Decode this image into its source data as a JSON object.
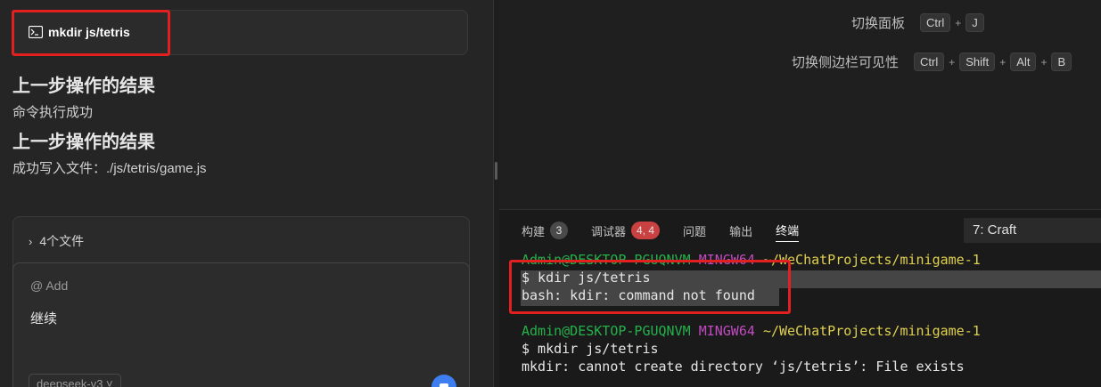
{
  "chat": {
    "command": "mkdir js/tetris",
    "results": [
      {
        "heading": "上一步操作的结果",
        "text": "命令执行成功"
      },
      {
        "heading": "上一步操作的结果",
        "text": "成功写入文件：./js/tetris/game.js"
      }
    ],
    "files_label": "4个文件",
    "add_label": "@ Add",
    "input_value": "继续",
    "model": "deepseek-v3 ˅"
  },
  "shortcuts": [
    {
      "label": "切换面板",
      "keys": [
        "Ctrl",
        "J"
      ]
    },
    {
      "label": "切换侧边栏可见性",
      "keys": [
        "Ctrl",
        "Shift",
        "Alt",
        "B"
      ]
    }
  ],
  "panel": {
    "tabs": [
      {
        "label": "构建",
        "badge": "3"
      },
      {
        "label": "调试器",
        "badge": "4, 4"
      },
      {
        "label": "问题",
        "badge": ""
      },
      {
        "label": "输出",
        "badge": ""
      },
      {
        "label": "终端",
        "badge": ""
      }
    ],
    "terminal_select": "7: Craft"
  },
  "terminal": {
    "prompt1": {
      "user": "Admin@DESKTOP-PGUQNVM",
      "env": "MINGW64",
      "path": "~/WeChatProjects/minigame-1"
    },
    "line2": "$ kdir js/tetris",
    "line3": "bash: kdir: command not found",
    "prompt2": {
      "user": "Admin@DESKTOP-PGUQNVM",
      "env": "MINGW64",
      "path": "~/WeChatProjects/minigame-1"
    },
    "line5": "$ mkdir js/tetris",
    "line6": "mkdir: cannot create directory ‘js/tetris’: File exists"
  },
  "colors": {
    "highlight_red": "#e22020",
    "prompt_green": "#24b24b",
    "prompt_magenta": "#c24bc2",
    "prompt_yellow": "#e0d04f",
    "badge_red": "#c94140",
    "send_blue": "#3d7ff0"
  }
}
